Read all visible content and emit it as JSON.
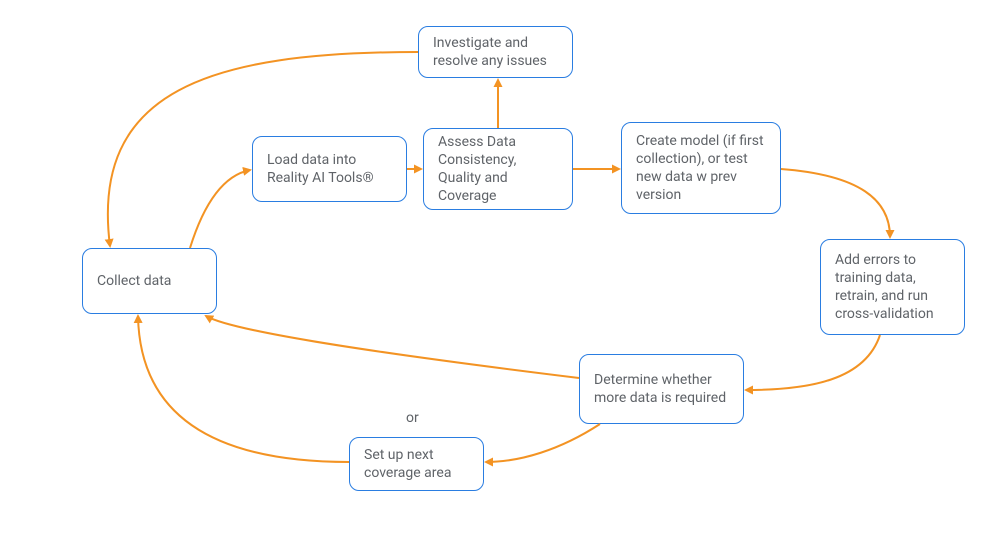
{
  "diagram": {
    "nodes": {
      "collect": {
        "text": "Collect data"
      },
      "load": {
        "text": "Load data into Reality AI Tools®"
      },
      "assess": {
        "text": "Assess Data Consistency, Quality and Coverage"
      },
      "investigate": {
        "text": "Investigate and resolve any issues"
      },
      "create": {
        "text": "Create model (if first collection), or test new data w prev version"
      },
      "adderrors": {
        "text": "Add errors to training data, retrain, and run cross-validation"
      },
      "determine": {
        "text": "Determine whether more data is required"
      },
      "setup": {
        "text": "Set up next coverage area"
      }
    },
    "labels": {
      "or": "or"
    },
    "edges": [
      {
        "from": "collect",
        "to": "load"
      },
      {
        "from": "load",
        "to": "assess"
      },
      {
        "from": "assess",
        "to": "investigate"
      },
      {
        "from": "investigate",
        "to": "collect"
      },
      {
        "from": "assess",
        "to": "create"
      },
      {
        "from": "create",
        "to": "adderrors"
      },
      {
        "from": "adderrors",
        "to": "determine"
      },
      {
        "from": "determine",
        "to": "collect",
        "label": "or"
      },
      {
        "from": "determine",
        "to": "setup"
      },
      {
        "from": "setup",
        "to": "collect"
      }
    ],
    "arrow_color": "#f39323"
  }
}
